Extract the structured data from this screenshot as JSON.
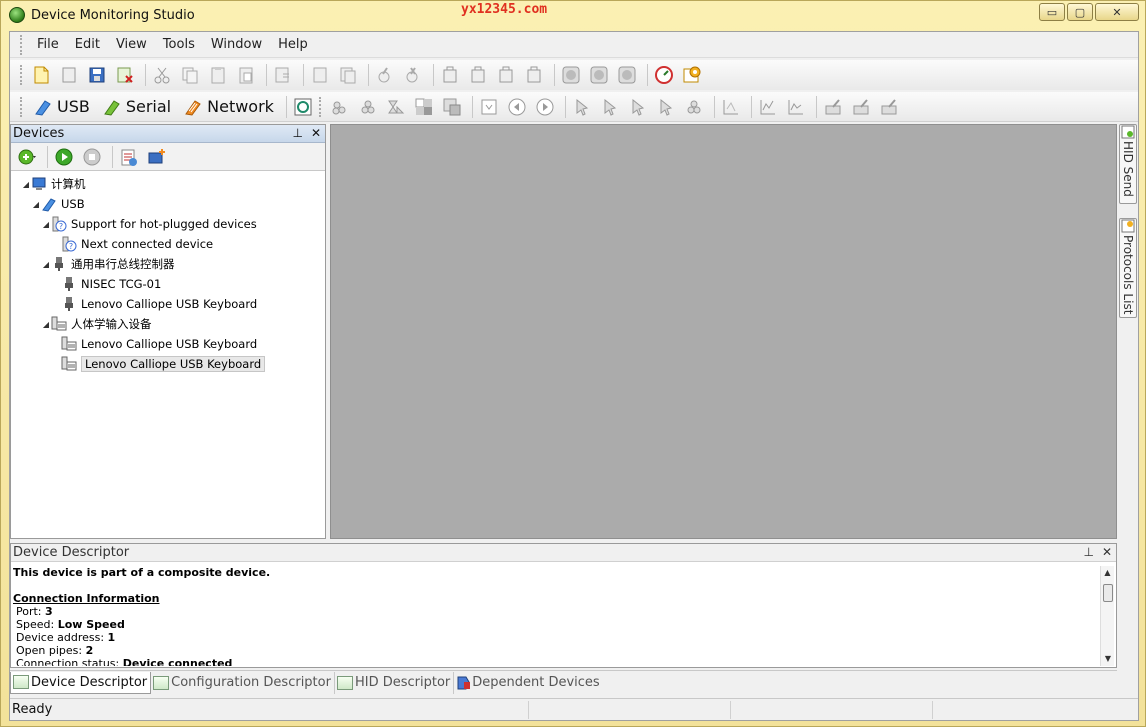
{
  "window": {
    "title": "Device Monitoring Studio",
    "watermark": "yx12345.com",
    "min_glyph": "▭",
    "max_glyph": "▢",
    "close_glyph": "✕"
  },
  "menu": [
    "File",
    "Edit",
    "View",
    "Tools",
    "Window",
    "Help"
  ],
  "protocols": {
    "usb": "USB",
    "serial": "Serial",
    "network": "Network"
  },
  "devices_pane": {
    "title": "Devices",
    "pin": "⊥",
    "close": "✕",
    "tree": [
      {
        "label": "计算机",
        "icon": "computer-icon",
        "indent": 0,
        "arrow": "◢"
      },
      {
        "label": "USB",
        "icon": "usb-icon",
        "indent": 1,
        "arrow": "◢"
      },
      {
        "label": "Support for hot-plugged devices",
        "icon": "hotplug-icon",
        "indent": 2,
        "arrow": "◢"
      },
      {
        "label": "Next connected device",
        "icon": "question-device-icon",
        "indent": 3,
        "arrow": ""
      },
      {
        "label": "通用串行总线控制器",
        "icon": "usb-plug-icon",
        "indent": 2,
        "arrow": "◢"
      },
      {
        "label": "NISEC TCG-01",
        "icon": "usb-plug-icon",
        "indent": 3,
        "arrow": ""
      },
      {
        "label": "Lenovo Calliope USB Keyboard",
        "icon": "usb-plug-icon",
        "indent": 3,
        "arrow": ""
      },
      {
        "label": "人体学输入设备",
        "icon": "hid-icon",
        "indent": 2,
        "arrow": "◢"
      },
      {
        "label": "Lenovo Calliope USB Keyboard",
        "icon": "hid-icon",
        "indent": 3,
        "arrow": ""
      },
      {
        "label": "Lenovo Calliope USB Keyboard",
        "icon": "hid-icon",
        "indent": 3,
        "arrow": "",
        "selected": true
      }
    ]
  },
  "side_tabs": {
    "hid_send": "HID Send",
    "protocols_list": "Protocols List"
  },
  "descriptor_pane": {
    "title": "Device Descriptor",
    "pin": "⊥",
    "close": "✕",
    "composite_note": "This device is part of a composite device.",
    "section_title": "Connection Information",
    "port_label": "Port:",
    "port_value": "3",
    "speed_label": "Speed:",
    "speed_value": "Low Speed",
    "address_label": "Device address:",
    "address_value": "1",
    "pipes_label": "Open pipes:",
    "pipes_value": "2",
    "status_label": "Connection status:",
    "status_value": "Device connected"
  },
  "bottom_tabs": [
    "Device Descriptor",
    "Configuration Descriptor",
    "HID Descriptor",
    "Dependent Devices"
  ],
  "status": {
    "text": "Ready"
  },
  "colors": {
    "frame": "#f5e9a6",
    "workspace": "#ababab",
    "pane_header": "#c7d7ea",
    "watermark": "#e03020"
  }
}
